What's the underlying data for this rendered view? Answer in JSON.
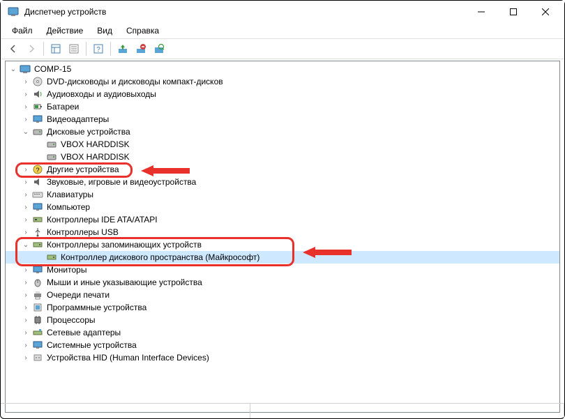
{
  "window": {
    "title": "Диспетчер устройств"
  },
  "menu": {
    "file": "Файл",
    "action": "Действие",
    "view": "Вид",
    "help": "Справка"
  },
  "tree": {
    "root": "COMP-15",
    "dvd": "DVD-дисководы и дисководы компакт-дисков",
    "audio": "Аудиовходы и аудиовыходы",
    "battery": "Батареи",
    "video": "Видеоадаптеры",
    "disk": "Дисковые устройства",
    "disk1": "VBOX HARDDISK",
    "disk2": "VBOX HARDDISK",
    "other": "Другие устройства",
    "sound": "Звуковые, игровые и видеоустройства",
    "keyboard": "Клавиатуры",
    "computer": "Компьютер",
    "ide": "Контроллеры IDE ATA/ATAPI",
    "usb": "Контроллеры USB",
    "storage": "Контроллеры запоминающих устройств",
    "storage_ctrl": "Контроллер дискового пространства (Майкрософт)",
    "monitor": "Мониторы",
    "mouse": "Мыши и иные указывающие устройства",
    "print": "Очереди печати",
    "software": "Программные устройства",
    "cpu": "Процессоры",
    "network": "Сетевые адаптеры",
    "system": "Системные устройства",
    "hid": "Устройства HID (Human Interface Devices)"
  }
}
